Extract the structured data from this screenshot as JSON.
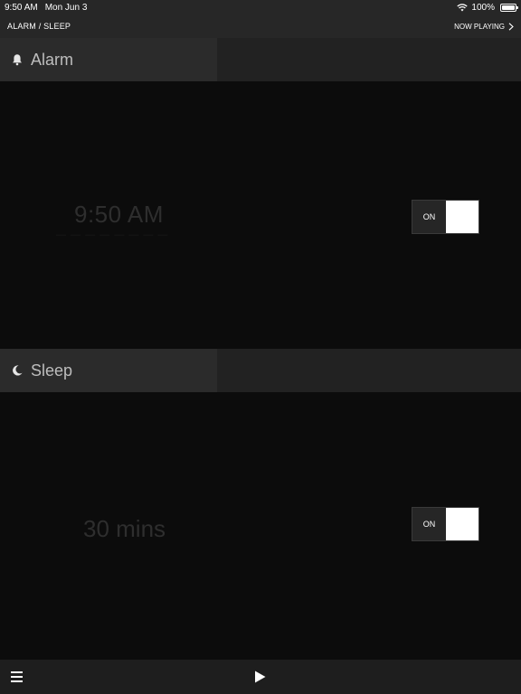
{
  "status_bar": {
    "time": "9:50 AM",
    "date": "Mon Jun 3",
    "battery": "100%",
    "wifi_icon": "wifi-icon",
    "battery_icon": "battery-icon"
  },
  "nav": {
    "title": "ALARM / SLEEP",
    "now_playing": "NOW PLAYING",
    "chevron_icon": "chevron-right-icon"
  },
  "alarm": {
    "header_label": "Alarm",
    "icon": "bell-icon",
    "time": "9:50 AM",
    "subtext": "— — — — — — — —",
    "toggle_label": "ON",
    "enabled": true
  },
  "sleep": {
    "header_label": "Sleep",
    "icon": "moon-icon",
    "duration": "30 mins",
    "toggle_label": "ON",
    "enabled": true
  },
  "bottom_bar": {
    "menu_icon": "menu-icon",
    "play_icon": "play-icon"
  },
  "colors": {
    "background": "#0c0c0c",
    "bar": "#272727",
    "header_tab": "#2b2b2b",
    "toggle_on": "#ffffff"
  }
}
